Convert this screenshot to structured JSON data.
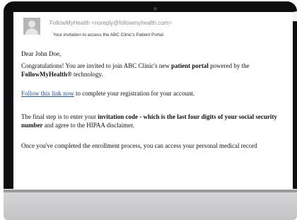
{
  "email": {
    "sender": "FollowMyHealth <noreply@followmyhealth.com>",
    "subject": "Your invitation to access the ABC Clinic's Patient Portal",
    "greeting": "Dear John Doe,",
    "congrats": {
      "part1": "Congratulations! You are invited to join ABC Clinic's new ",
      "bold1": "patient portal",
      "part2": " powered by the ",
      "bold2": "FollowMyHealth®",
      "part3": " technology."
    },
    "link": {
      "link_text": "Follow this link now",
      "rest": " to complete your registration for your account."
    },
    "final_step": {
      "part1": "The final step is to enter your ",
      "bold1": "invitation code - which is the last four digits of your social security number",
      "part2": " and agree to the HIPAA disclaimer."
    },
    "enrollment": "Once you've completed the enrollment process, you can access your personal medical record"
  },
  "icons": {
    "avatar": "default-user-avatar"
  }
}
